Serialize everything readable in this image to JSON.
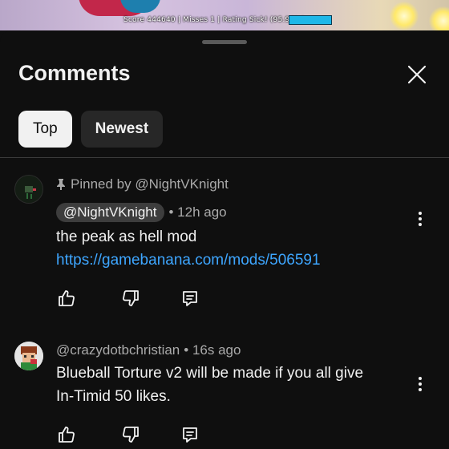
{
  "video": {
    "hud_text": "Score 444640 | Misses 1 | Rating Sick! (95.96%)"
  },
  "sheet": {
    "title": "Comments",
    "close_icon": "close-icon"
  },
  "chips": [
    {
      "label": "Top",
      "active": true
    },
    {
      "label": "Newest",
      "active": false
    }
  ],
  "comments": [
    {
      "pinned_label": "Pinned by @NightVKnight",
      "author": "@NightVKnight",
      "time": "• 12h ago",
      "text": "the peak as hell mod",
      "link": "https://gamebanana.com/mods/506591"
    },
    {
      "author": "@crazydotbchristian",
      "time": "• 16s ago",
      "text_line1": "Blueball Torture v2 will be made if you all give",
      "text_line2": "In-Timid 50 likes."
    }
  ],
  "actions": {
    "like_icon": "thumbs-up-icon",
    "dislike_icon": "thumbs-down-icon",
    "reply_icon": "reply-icon"
  },
  "colors": {
    "background": "#0f0f0f",
    "link": "#3ea6ff",
    "secondary_text": "#aaaaaa"
  }
}
